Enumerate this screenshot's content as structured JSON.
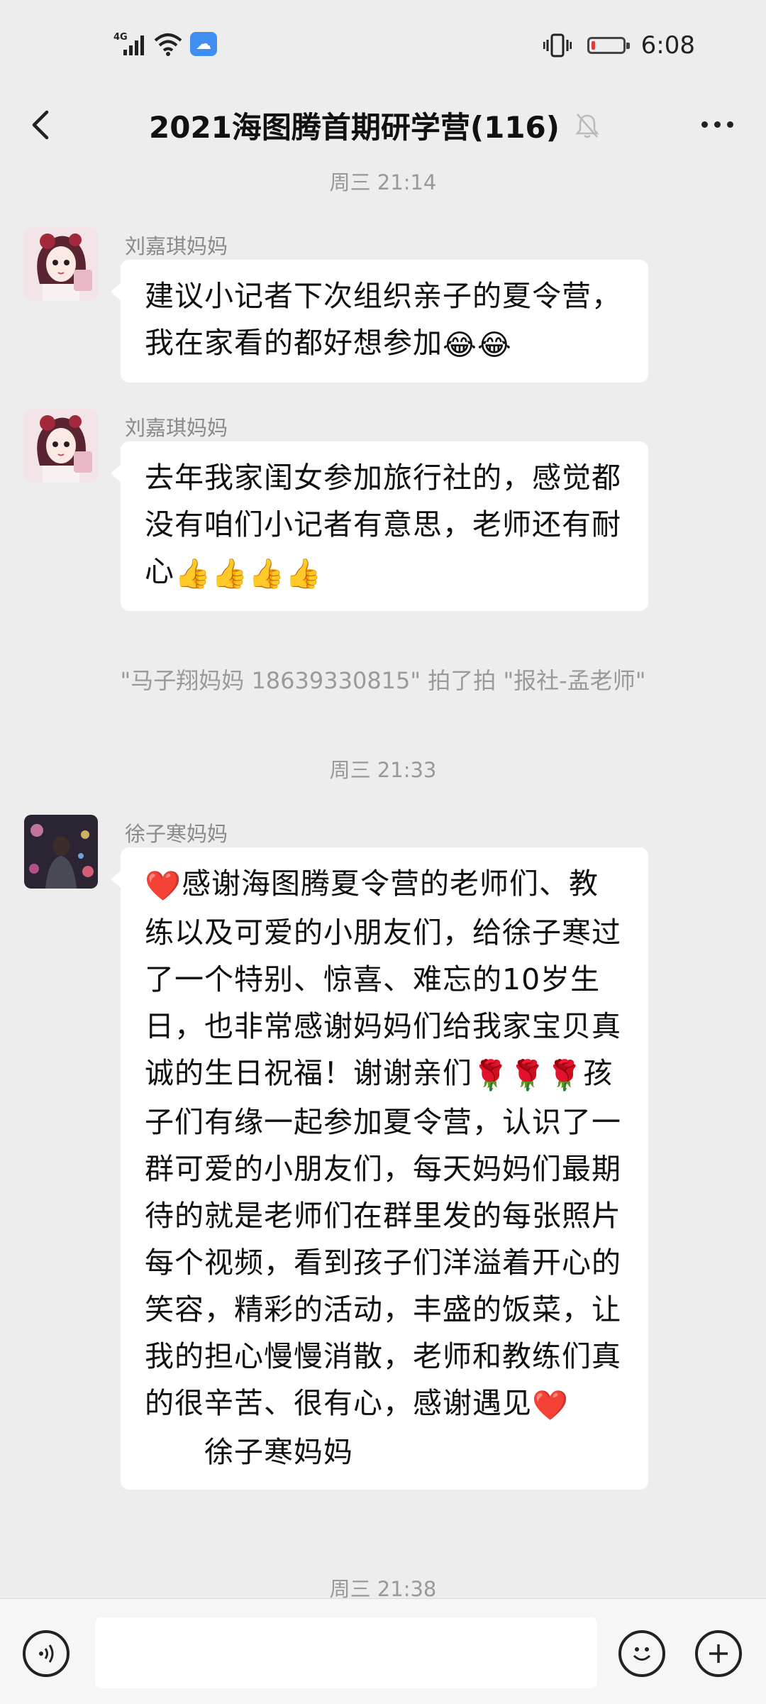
{
  "status_bar": {
    "network": "4G",
    "time": "6:08",
    "battery_level": 0.12,
    "battery_color": "#e23a3a",
    "icons": [
      "signal-icon",
      "wifi-icon",
      "cloud-icon",
      "vibrate-icon",
      "battery-icon"
    ]
  },
  "header": {
    "title": "2021海图腾首期研学营(116)",
    "icons": [
      "back-arrow-icon",
      "mute-bell-icon",
      "more-dots-icon"
    ]
  },
  "chat": {
    "timestamp_1": "周三 21:14",
    "msg1": {
      "sender": "刘嘉琪妈妈",
      "text": "建议小记者下次组织亲子的夏令营，我在家看的都好想参加",
      "emojis": [
        "😂",
        "😂"
      ]
    },
    "msg2": {
      "sender": "刘嘉琪妈妈",
      "text": "去年我家闺女参加旅行社的，感觉都没有咱们小记者有意思，老师还有耐心",
      "emojis": [
        "👍",
        "👍",
        "👍",
        "👍"
      ]
    },
    "system_pat": "\"马子翔妈妈 18639330815\" 拍了拍 \"报社-孟老师\"",
    "timestamp_2": "周三 21:33",
    "msg3": {
      "sender": "徐子寒妈妈",
      "lead_emoji": "❤️",
      "part1": "感谢海图腾夏令营的老师们、教练以及可爱的小朋友们，给徐子寒过了一个特别、惊喜、难忘的10岁生日，也非常感谢妈妈们给我家宝贝真诚的生日祝福！谢谢亲们",
      "mid_emojis": [
        "🌹",
        "🌹",
        "🌹"
      ],
      "part2": "孩子们有缘一起参加夏令营，认识了一群可爱的小朋友们，每天妈妈们最期待的就是老师们在群里发的每张照片每个视频，看到孩子们洋溢着开心的笑容，精彩的活动，丰盛的饭菜，让我的担心慢慢消散，老师和教练们真的很辛苦、很有心，感谢遇见",
      "end_emoji": "❤️",
      "signature": "徐子寒妈妈"
    },
    "timestamp_3": "周三 21:38"
  },
  "input_bar": {
    "value": "",
    "icons": [
      "voice-icon",
      "emoji-face-icon",
      "plus-icon"
    ]
  }
}
